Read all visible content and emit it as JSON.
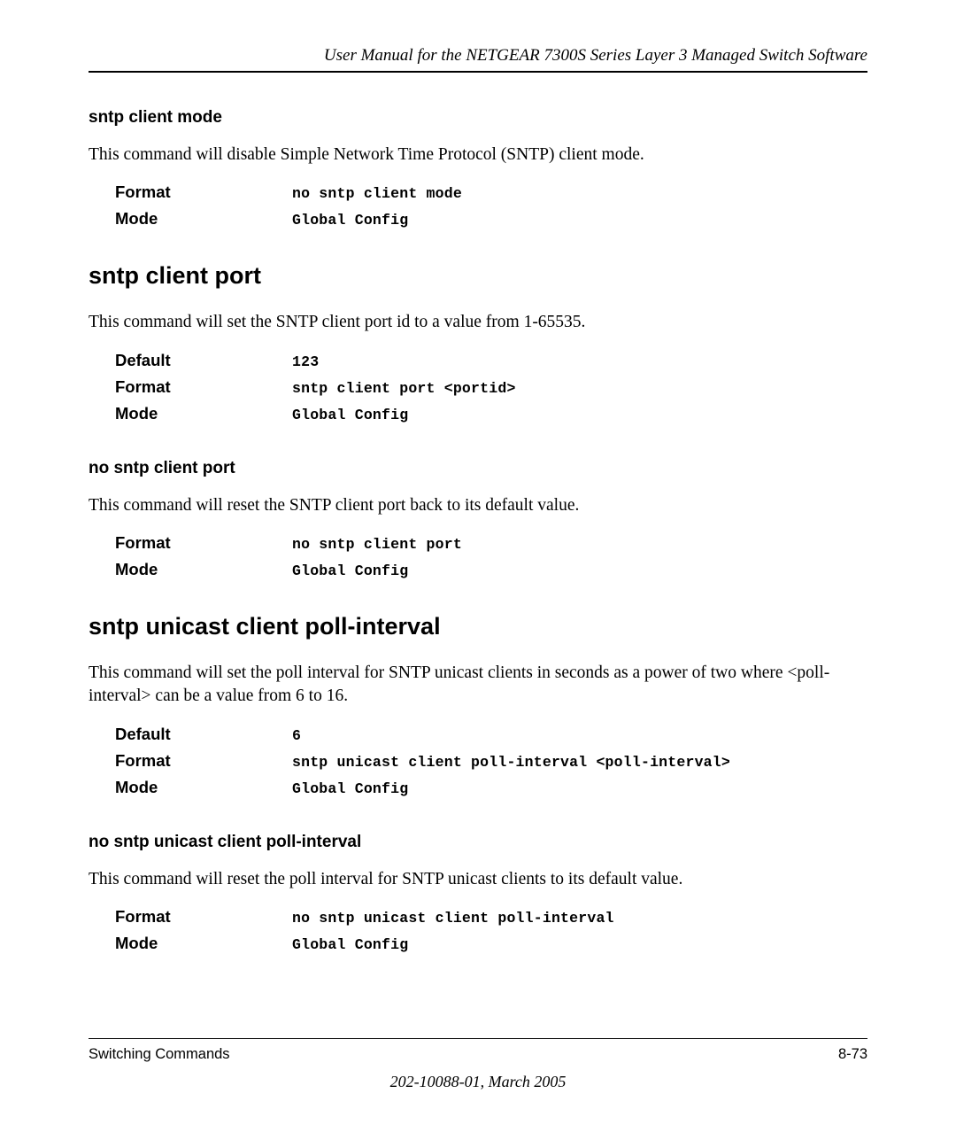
{
  "header": {
    "title": "User Manual for the NETGEAR 7300S Series Layer 3 Managed Switch Software"
  },
  "section1": {
    "title": "sntp client mode",
    "desc": "This command will disable Simple Network Time Protocol (SNTP) client mode.",
    "labels": {
      "format": "Format",
      "mode": "Mode"
    },
    "values": {
      "format": "no sntp client mode",
      "mode": "Global Config"
    }
  },
  "section2": {
    "title": "sntp client port",
    "desc": "This command will set the SNTP client port id to a value from 1-65535.",
    "labels": {
      "default": "Default",
      "format": "Format",
      "mode": "Mode"
    },
    "values": {
      "default": "123",
      "format": "sntp client port <portid>",
      "mode": "Global Config"
    }
  },
  "section3": {
    "title": "no sntp client port",
    "desc": "This command will reset the SNTP client port back to its default value.",
    "labels": {
      "format": "Format",
      "mode": "Mode"
    },
    "values": {
      "format": "no sntp client port",
      "mode": "Global Config"
    }
  },
  "section4": {
    "title": "sntp unicast client poll-interval",
    "desc": "This command will set the poll interval for SNTP unicast clients in seconds as a power of two where <poll-interval> can be a value from 6 to 16.",
    "labels": {
      "default": "Default",
      "format": "Format",
      "mode": "Mode"
    },
    "values": {
      "default": "6",
      "format": "sntp unicast client poll-interval <poll-interval>",
      "mode": "Global Config"
    }
  },
  "section5": {
    "title": "no sntp unicast client poll-interval",
    "desc": "This command will reset the poll interval for SNTP unicast clients to its default value.",
    "labels": {
      "format": "Format",
      "mode": "Mode"
    },
    "values": {
      "format": "no sntp unicast client poll-interval",
      "mode": "Global Config"
    }
  },
  "footer": {
    "left": "Switching Commands",
    "right": "8-73",
    "center": "202-10088-01, March 2005"
  }
}
